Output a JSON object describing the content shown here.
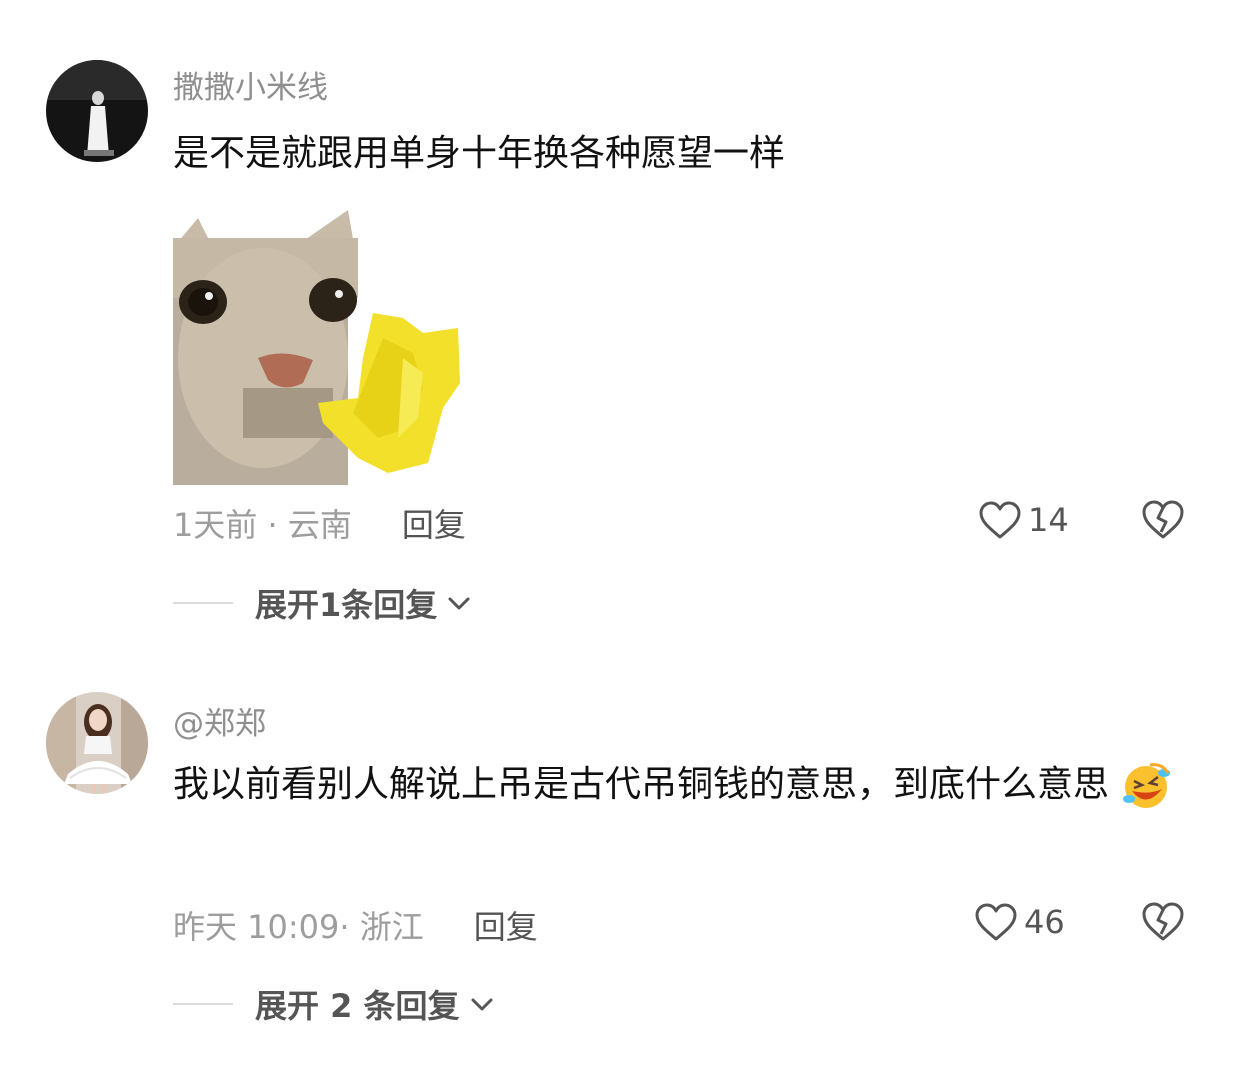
{
  "comments": [
    {
      "username": "撒撒小米线",
      "text": "是不是就跟用单身十年换各种愿望一样",
      "has_sticker": true,
      "time": "1天前",
      "location": "云南",
      "meta": "1天前 · 云南",
      "reply_label": "回复",
      "likes": "14",
      "expand_label": "展开1条回复"
    },
    {
      "username": "@郑郑",
      "text": "我以前看别人解说上吊是古代吊铜钱的意思，到底什么意思",
      "emoji": "rolling-on-floor-laughing",
      "time": "昨天 10:09",
      "location": "浙江",
      "meta": "昨天 10:09· 浙江",
      "reply_label": "回复",
      "likes": "46",
      "expand_label": "展开 2 条回复"
    }
  ],
  "colors": {
    "username": "#8f8f8f",
    "text": "#111111",
    "meta": "#9d9d9d",
    "action": "#555555"
  }
}
